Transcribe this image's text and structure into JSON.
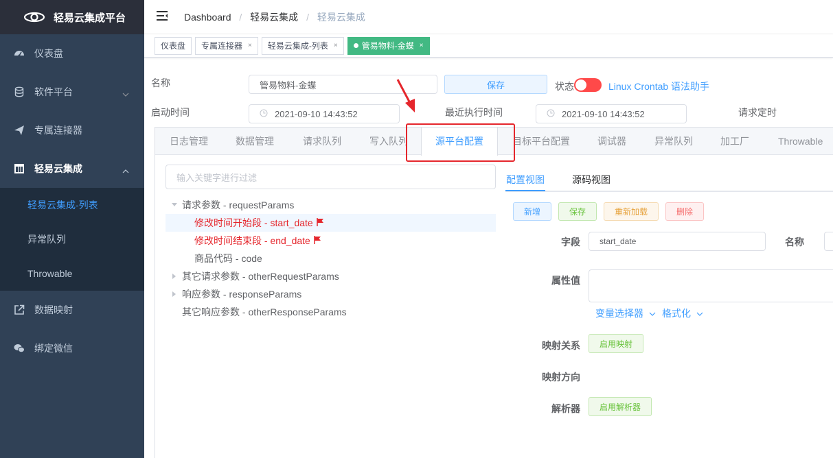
{
  "sidebar": {
    "logo_text": "轻易云集成平台",
    "items": [
      {
        "label": "仪表盘",
        "icon": "dashboard-icon"
      },
      {
        "label": "软件平台",
        "icon": "database-icon"
      },
      {
        "label": "专属连接器",
        "icon": "paper-plane-icon"
      },
      {
        "label": "轻易云集成",
        "icon": "grid-icon"
      },
      {
        "label": "数据映射",
        "icon": "external-link-icon"
      },
      {
        "label": "绑定微信",
        "icon": "wechat-icon"
      }
    ],
    "submenu": [
      {
        "label": "轻易云集成-列表"
      },
      {
        "label": "异常队列"
      },
      {
        "label": "Throwable"
      }
    ]
  },
  "header": {
    "breadcrumb": [
      "Dashboard",
      "轻易云集成",
      "轻易云集成"
    ]
  },
  "tags": [
    {
      "label": "仪表盘"
    },
    {
      "label": "专属连接器"
    },
    {
      "label": "轻易云集成-列表"
    },
    {
      "label": "管易物料-金蝶"
    }
  ],
  "form": {
    "name_label": "名称",
    "name_value": "管易物料-金蝶",
    "save_label": "保存",
    "status_label": "状态",
    "crontab_link": "Linux Crontab 语法助手",
    "start_time_label": "启动时间",
    "start_time_value": "2021-09-10 14:43:52",
    "last_exec_label": "最近执行时间",
    "last_exec_value": "2021-09-10 14:43:52",
    "request_timer_label": "请求定时"
  },
  "tabs": [
    {
      "label": "日志管理"
    },
    {
      "label": "数据管理"
    },
    {
      "label": "请求队列"
    },
    {
      "label": "写入队列"
    },
    {
      "label": "源平台配置"
    },
    {
      "label": "目标平台配置"
    },
    {
      "label": "调试器"
    },
    {
      "label": "异常队列"
    },
    {
      "label": "加工厂"
    },
    {
      "label": "Throwable"
    }
  ],
  "tree": {
    "filter_placeholder": "输入关键字进行过滤",
    "nodes": [
      {
        "label": "请求参数 - requestParams"
      },
      {
        "label": "修改时间开始段 - start_date"
      },
      {
        "label": "修改时间结束段 - end_date"
      },
      {
        "label": "商品代码 - code"
      },
      {
        "label": "其它请求参数 - otherRequestParams"
      },
      {
        "label": "响应参数 - responseParams"
      },
      {
        "label": "其它响应参数 - otherResponseParams"
      }
    ]
  },
  "panel": {
    "view_tabs": [
      "配置视图",
      "源码视图"
    ],
    "buttons": {
      "add": "新增",
      "save": "保存",
      "reload": "重新加载",
      "delete": "删除"
    },
    "field_label": "字段",
    "field_value": "start_date",
    "name_label": "名称",
    "attr_label": "属性值",
    "var_selector": "变量选择器",
    "format": "格式化",
    "mapping_label": "映射关系",
    "enable_mapping": "启用映射",
    "mapping_dir_label": "映射方向",
    "parser_label": "解析器",
    "enable_parser": "启用解析器"
  },
  "colors": {
    "sidebar_bg": "#304156",
    "accent": "#409eff",
    "active_tag": "#42b983",
    "highlight_red": "#e5262c"
  }
}
